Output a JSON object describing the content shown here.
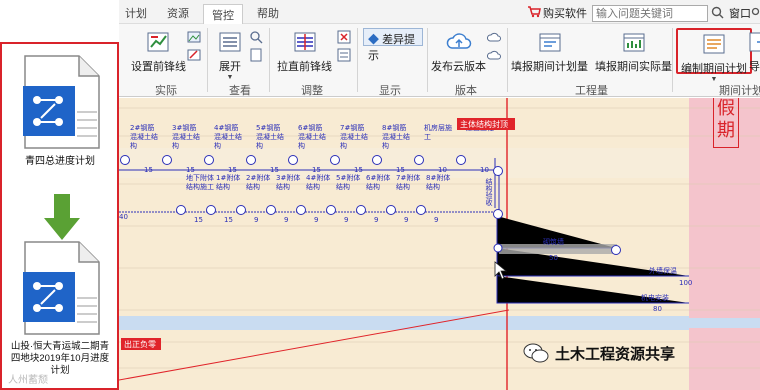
{
  "left_panel": {
    "file1_label": "青四总进度计划",
    "file2_label": "山投·恒大青运城二期青四地块2019年10月进度计划",
    "watermark": "人州蓄颓"
  },
  "tabs": [
    "计划",
    "资源",
    "管控",
    "帮助"
  ],
  "top_right": {
    "buy_label": "购买软件",
    "search_placeholder": "输入问题关键词",
    "window_label": "窗口"
  },
  "ribbon": {
    "set_baseline": "设置前锋线",
    "expand": "展开",
    "straighten": "拉直前锋线",
    "diff": "差异提示",
    "publish": "发布云版本",
    "fill_plan": "填报期间计划量",
    "fill_actual": "填报期间实际量",
    "edit_period": "编制期间计划",
    "export": "导出",
    "groups": [
      "实际",
      "查看",
      "调整",
      "显示",
      "版本",
      "工程量",
      "期间计划"
    ]
  },
  "canvas": {
    "holiday_text": "假期",
    "milestone_top": "主体结构封顶",
    "milestone_bottom": "出正负零",
    "row1_tasks": [
      {
        "text": "2#钢筋混凝土结构",
        "d": "15"
      },
      {
        "text": "3#钢筋混凝土结构",
        "d": "15"
      },
      {
        "text": "4#钢筋混凝土结构",
        "d": "15"
      },
      {
        "text": "5#钢筋混凝土结构",
        "d": "15"
      },
      {
        "text": "6#钢筋混凝土结构",
        "d": "15"
      },
      {
        "text": "7#钢筋混凝土结构",
        "d": "15"
      },
      {
        "text": "8#钢筋混凝土结构",
        "d": "15"
      },
      {
        "text": "机房层施工",
        "d": "10"
      },
      {
        "text": "屋面工程",
        "d": "10"
      }
    ],
    "row2_tasks": [
      {
        "text": "地下附体结构施工",
        "d": "15"
      },
      {
        "text": "1#附体结构",
        "d": "15"
      },
      {
        "text": "2#附体结构",
        "d": "9"
      },
      {
        "text": "3#附体结构",
        "d": "9"
      },
      {
        "text": "4#附体结构",
        "d": "9"
      },
      {
        "text": "5#附体结构",
        "d": "9"
      },
      {
        "text": "6#附体结构",
        "d": "9"
      },
      {
        "text": "7#附体结构",
        "d": "9"
      },
      {
        "text": "8#附体结构",
        "d": "9"
      }
    ],
    "left_num": "40",
    "vertical_task": "结构验收",
    "task_a": "砌筑墙",
    "task_a_d": "50",
    "task_b": "外墙保温",
    "task_b_d": "100",
    "task_c": "机电安装",
    "task_c_d": "80"
  },
  "wechat_watermark": "土木工程资源共享",
  "colors": {
    "accent": "#d9232a",
    "canvas_bg": "#f8ebd3",
    "holiday_bg": "#f4c4cc",
    "net_blue": "#2b2fb8"
  }
}
